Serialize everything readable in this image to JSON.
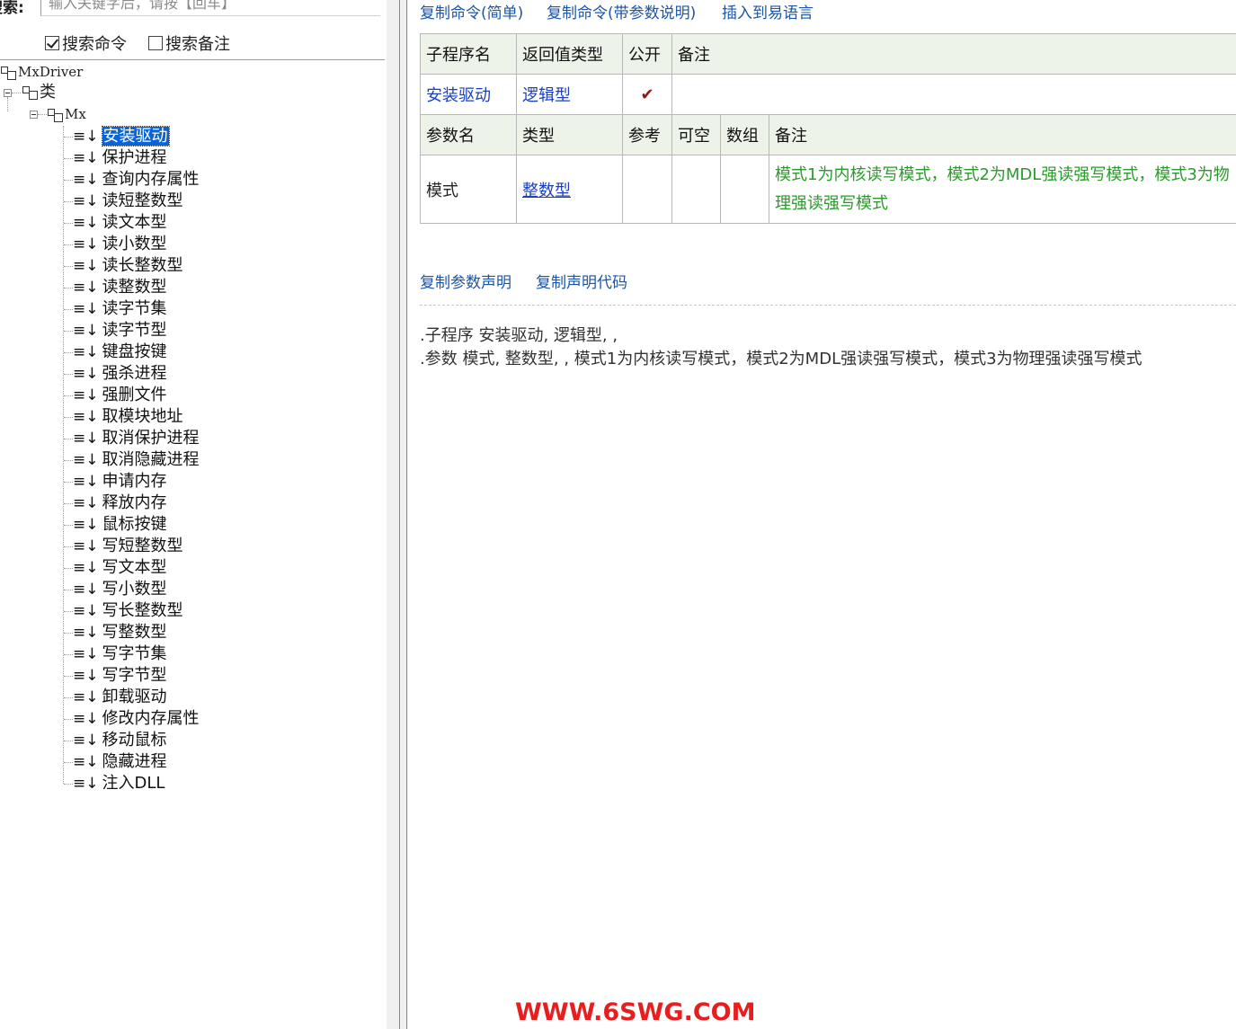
{
  "search": {
    "label": "搜索:",
    "placeholder": "输入关键字后，请按【回车】",
    "value": ""
  },
  "options": [
    {
      "label": "搜索命令",
      "checked": true
    },
    {
      "label": "搜索备注",
      "checked": false
    }
  ],
  "tree": {
    "root": "MxDriver",
    "category": "类",
    "class": "Mx",
    "selected_index": 0,
    "items": [
      "安装驱动",
      "保护进程",
      "查询内存属性",
      "读短整数型",
      "读文本型",
      "读小数型",
      "读长整数型",
      "读整数型",
      "读字节集",
      "读字节型",
      "键盘按键",
      "强杀进程",
      "强删文件",
      "取模块地址",
      "取消保护进程",
      "取消隐藏进程",
      "申请内存",
      "释放内存",
      "鼠标按键",
      "写短整数型",
      "写文本型",
      "写小数型",
      "写长整数型",
      "写整数型",
      "写字节集",
      "写字节型",
      "卸载驱动",
      "修改内存属性",
      "移动鼠标",
      "隐藏进程",
      "注入DLL"
    ]
  },
  "command_links": [
    "复制命令(简单)",
    "复制命令(带参数说明)",
    "插入到易语言"
  ],
  "info_table": {
    "headers": [
      "子程序名",
      "返回值类型",
      "公开",
      "备注"
    ],
    "row": {
      "name": "安装驱动",
      "return_type": "逻辑型",
      "public": "✔",
      "note": ""
    },
    "param_headers": [
      "参数名",
      "类型",
      "参考",
      "可空",
      "数组",
      "备注"
    ],
    "params": [
      {
        "name": "模式",
        "type": "整数型",
        "ref": "",
        "nullable": "",
        "array": "",
        "note": "模式1为内核读写模式，模式2为MDL强读强写模式，模式3为物理强读强写模式"
      }
    ]
  },
  "copy_links": [
    "复制参数声明",
    "复制声明代码"
  ],
  "declaration": {
    "line1": ".子程序 安装驱动, 逻辑型, ,",
    "line2": ".参数 模式, 整数型, , 模式1为内核读写模式，模式2为MDL强读强写模式，模式3为物理强读强写模式"
  },
  "watermark": "WWW.6SWG.COM",
  "colors": {
    "link": "#1a55a8",
    "type_link": "#1a3fbf",
    "note_green": "#2a9a2a",
    "header_bg": "#eef3ea",
    "selection": "#0a64d6",
    "watermark": "#e81e1e"
  }
}
